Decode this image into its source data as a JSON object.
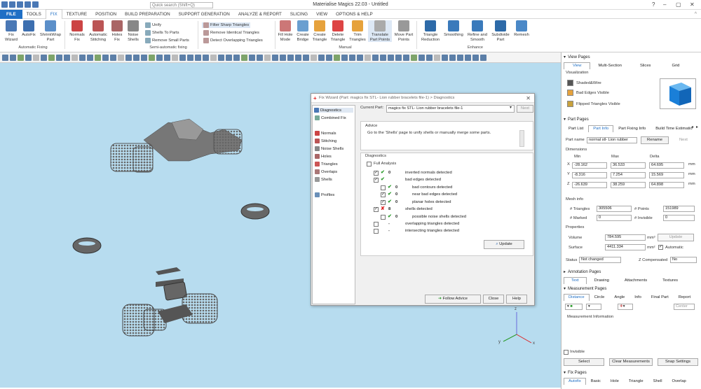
{
  "app": {
    "title": "Materialise Magics 22.03 - Untitled",
    "search_placeholder": "Quick search (Shift+Q)"
  },
  "menu": [
    "FILE",
    "TOOLS",
    "FIX",
    "TEXTURE",
    "POSITION",
    "BUILD PREPARATION",
    "SUPPORT GENERATION",
    "ANALYZE & REPORT",
    "SLICING",
    "VIEW",
    "OPTIONS & HELP"
  ],
  "ribbon": {
    "auto": [
      {
        "label": "Fix",
        "label2": "Wizard"
      },
      {
        "label": "AutoFix",
        "label2": ""
      },
      {
        "label": "ShrinkWrap",
        "label2": "Part"
      }
    ],
    "auto_group": "Automatic Fixing",
    "semi": [
      {
        "label": "Normals",
        "label2": "Fix"
      },
      {
        "label": "Automatic",
        "label2": "Stitching"
      },
      {
        "label": "Holes",
        "label2": "Fix"
      },
      {
        "label": "Noise",
        "label2": "Shells"
      }
    ],
    "semi_small": [
      "Unify",
      "Shells To Parts",
      "Remove Small Parts"
    ],
    "semi_group": "Semi-automatic fixing",
    "filters": [
      "Filter Sharp Triangles",
      "Remove Identical Triangles",
      "Detect Overlapping Triangles"
    ],
    "manual": [
      {
        "label": "Fill Hole",
        "label2": "Mode"
      },
      {
        "label": "Create",
        "label2": "Bridge"
      },
      {
        "label": "Create",
        "label2": "Triangle"
      },
      {
        "label": "Delete",
        "label2": "Triangle"
      },
      {
        "label": "Trim",
        "label2": "Triangles"
      },
      {
        "label": "Translate",
        "label2": "Part Points"
      },
      {
        "label": "Move Part",
        "label2": "Points"
      }
    ],
    "manual_group": "Manual",
    "enhance": [
      {
        "label": "Triangle",
        "label2": "Reduction"
      },
      {
        "label": "Smoothing",
        "label2": ""
      },
      {
        "label": "Refine and",
        "label2": "Smooth"
      },
      {
        "label": "Subdivide",
        "label2": "Part"
      },
      {
        "label": "Remesh",
        "label2": ""
      }
    ],
    "enhance_group": "Enhance"
  },
  "dialog": {
    "title": "Fix Wizard (Part: magics fix STL- Lion rubber bracelets file-1) > Diagnostics",
    "nav": [
      "Diagnostics",
      "Combined Fix",
      "Normals",
      "Stitching",
      "Noise Shells",
      "Holes",
      "Triangles",
      "Overlaps",
      "Shells",
      "Profiles"
    ],
    "current_part_label": "Current Part:",
    "current_part": "magics fix STL- Lion rubber bracelets file-1",
    "next": "Next",
    "advice_header": "Advice",
    "advice_text": "Go to the 'Shells' page to unify shells or manually merge some parts.",
    "diag_header": "Diagnostics",
    "full_analysis": "Full Analysis",
    "rows": [
      {
        "count": "0",
        "text": "inverted normals detected",
        "status": "ok",
        "checked": "yes"
      },
      {
        "count": "",
        "text": "bad edges detected",
        "status": "ok",
        "checked": "yes"
      },
      {
        "count": "0",
        "text": "bad contours detected",
        "status": "ok",
        "checked": ""
      },
      {
        "count": "0",
        "text": "near bad edges detected",
        "status": "ok",
        "checked": "yes"
      },
      {
        "count": "0",
        "text": "planar holes detected",
        "status": "ok",
        "checked": "yes"
      },
      {
        "count": "8",
        "text": "shells detected",
        "status": "bad",
        "checked": "yes"
      },
      {
        "count": "0",
        "text": "possible noise shells detected",
        "status": "ok",
        "checked": ""
      },
      {
        "count": "-",
        "text": "overlapping triangles detected",
        "status": "none",
        "checked": ""
      },
      {
        "count": "-",
        "text": "intersecting triangles detected",
        "status": "none",
        "checked": ""
      }
    ],
    "update": "Update",
    "follow": "Follow Advice",
    "close": "Close",
    "help": "Help"
  },
  "panel": {
    "view_pages": "View Pages",
    "view_tabs": [
      "View",
      "Multi-Section",
      "Slices",
      "Grid"
    ],
    "visualization": "Visualization",
    "vis": [
      "Shaded&Wire",
      "Bad Edges Visible",
      "Flipped Triangles Visible"
    ],
    "part_pages": "Part Pages",
    "part_tabs": [
      "Part List",
      "Part Info",
      "Part Fixing Info",
      "Build Time Estimatio"
    ],
    "part_name_label": "Part name",
    "part_name": "normal stl- Lion rubber",
    "rename": "Rename",
    "next": "Next",
    "dimensions": "Dimensions",
    "dim_heads": [
      "Min",
      "Max",
      "Delta"
    ],
    "dims": [
      {
        "axis": "X",
        "min": "-28.162",
        "max": "36.533",
        "delta": "64.695",
        "unit": "mm"
      },
      {
        "axis": "Y",
        "min": "-8.316",
        "max": "7.254",
        "delta": "15.569",
        "unit": "mm"
      },
      {
        "axis": "Z",
        "min": "-26.639",
        "max": "38.259",
        "delta": "64.898",
        "unit": "mm"
      }
    ],
    "mesh_info": "Mesh info",
    "triangles_label": "# Triangles",
    "triangles": "305506",
    "points_label": "# Points",
    "points": "151989",
    "marked_label": "# Marked",
    "marked": "0",
    "invisible_label": "# Invisible",
    "invisible": "0",
    "properties": "Properties",
    "volume_label": "Volume",
    "volume": "784.595",
    "surface_label": "Surface",
    "surface": "4411.334",
    "unit3": "mm³",
    "unit2": "mm²",
    "update": "Update",
    "automatic": "Automatic",
    "status_label": "Status",
    "status": "Not changed",
    "zcomp_label": "Z Compensated",
    "zcomp": "No",
    "annotation_pages": "Annotation Pages",
    "annotation_tabs": [
      "Text",
      "Drawing",
      "Attachments",
      "Textures"
    ],
    "measurement_pages": "Measurement Pages",
    "measure_tabs": [
      "Distance",
      "Circle",
      "Angle",
      "Info",
      "Final Part",
      "Report"
    ],
    "center": "Center",
    "measurement_info": "Measurement Information",
    "invisible_chk": "Invisible",
    "select": "Select",
    "clear": "Clear Measurements",
    "snap": "Snap Settings",
    "fix_pages": "Fix Pages",
    "fix_tabs": [
      "Autofix",
      "Basic",
      "Hole",
      "Triangle",
      "Shell",
      "Overlap"
    ]
  },
  "axes": {
    "x": "x",
    "y": "y",
    "z": "z"
  },
  "colors": {
    "accent": "#1f6fc5",
    "viewport": "#b7dcef",
    "ok": "#2a9a2a",
    "bad": "#dd2222"
  }
}
